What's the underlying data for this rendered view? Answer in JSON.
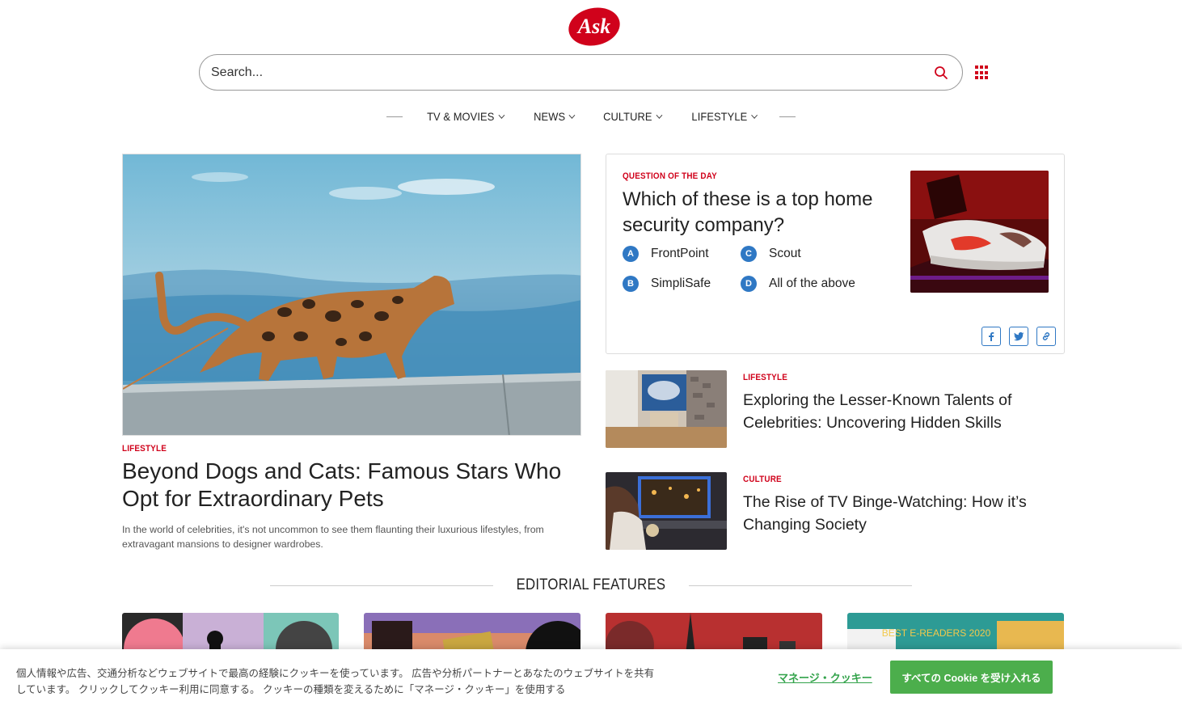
{
  "header": {
    "logo_text": "Ask",
    "search_placeholder": "Search..."
  },
  "nav": {
    "items": [
      {
        "label": "TV & MOVIES"
      },
      {
        "label": "NEWS"
      },
      {
        "label": "CULTURE"
      },
      {
        "label": "LIFESTYLE"
      }
    ]
  },
  "hero": {
    "tag": "LIFESTYLE",
    "title": "Beyond Dogs and Cats: Famous Stars Who Opt for Extraordinary Pets",
    "description": "In the world of celebrities, it's not uncommon to see them flaunting their luxurious lifestyles, from extravagant mansions to designer wardrobes."
  },
  "question": {
    "tag": "QUESTION OF THE DAY",
    "title": "Which of these is a top home security company?",
    "options": [
      {
        "letter": "A",
        "label": "FrontPoint"
      },
      {
        "letter": "B",
        "label": "SimpliSafe"
      },
      {
        "letter": "C",
        "label": "Scout"
      },
      {
        "letter": "D",
        "label": "All of the above"
      }
    ],
    "share_icons": [
      "facebook-icon",
      "twitter-icon",
      "link-icon"
    ]
  },
  "side_articles": [
    {
      "tag": "LIFESTYLE",
      "title": "Exploring the Lesser-Known Talents of Celebrities: Uncovering Hidden Skills"
    },
    {
      "tag": "CULTURE",
      "title": "The Rise of TV Binge-Watching: How it’s Changing Society"
    }
  ],
  "editorial": {
    "heading": "EDITORIAL FEATURES",
    "card_text": "BEST E-READERS 2020"
  },
  "cookie": {
    "text": "個人情報や広告、交通分析などウェブサイトで最高の経験にクッキーを使っています。 広告や分析パートナーとあなたのウェブサイトを共有しています。 クリックしてクッキー利用に同意する。 クッキーの種類を変えるために「マネージ・クッキー」を使用する",
    "manage_label": "マネージ・クッキー",
    "accept_label": "すべての Cookie を受け入れる"
  },
  "colors": {
    "brand_red": "#d0021b",
    "option_blue": "#2f78c4",
    "accept_green": "#4cae4c"
  }
}
